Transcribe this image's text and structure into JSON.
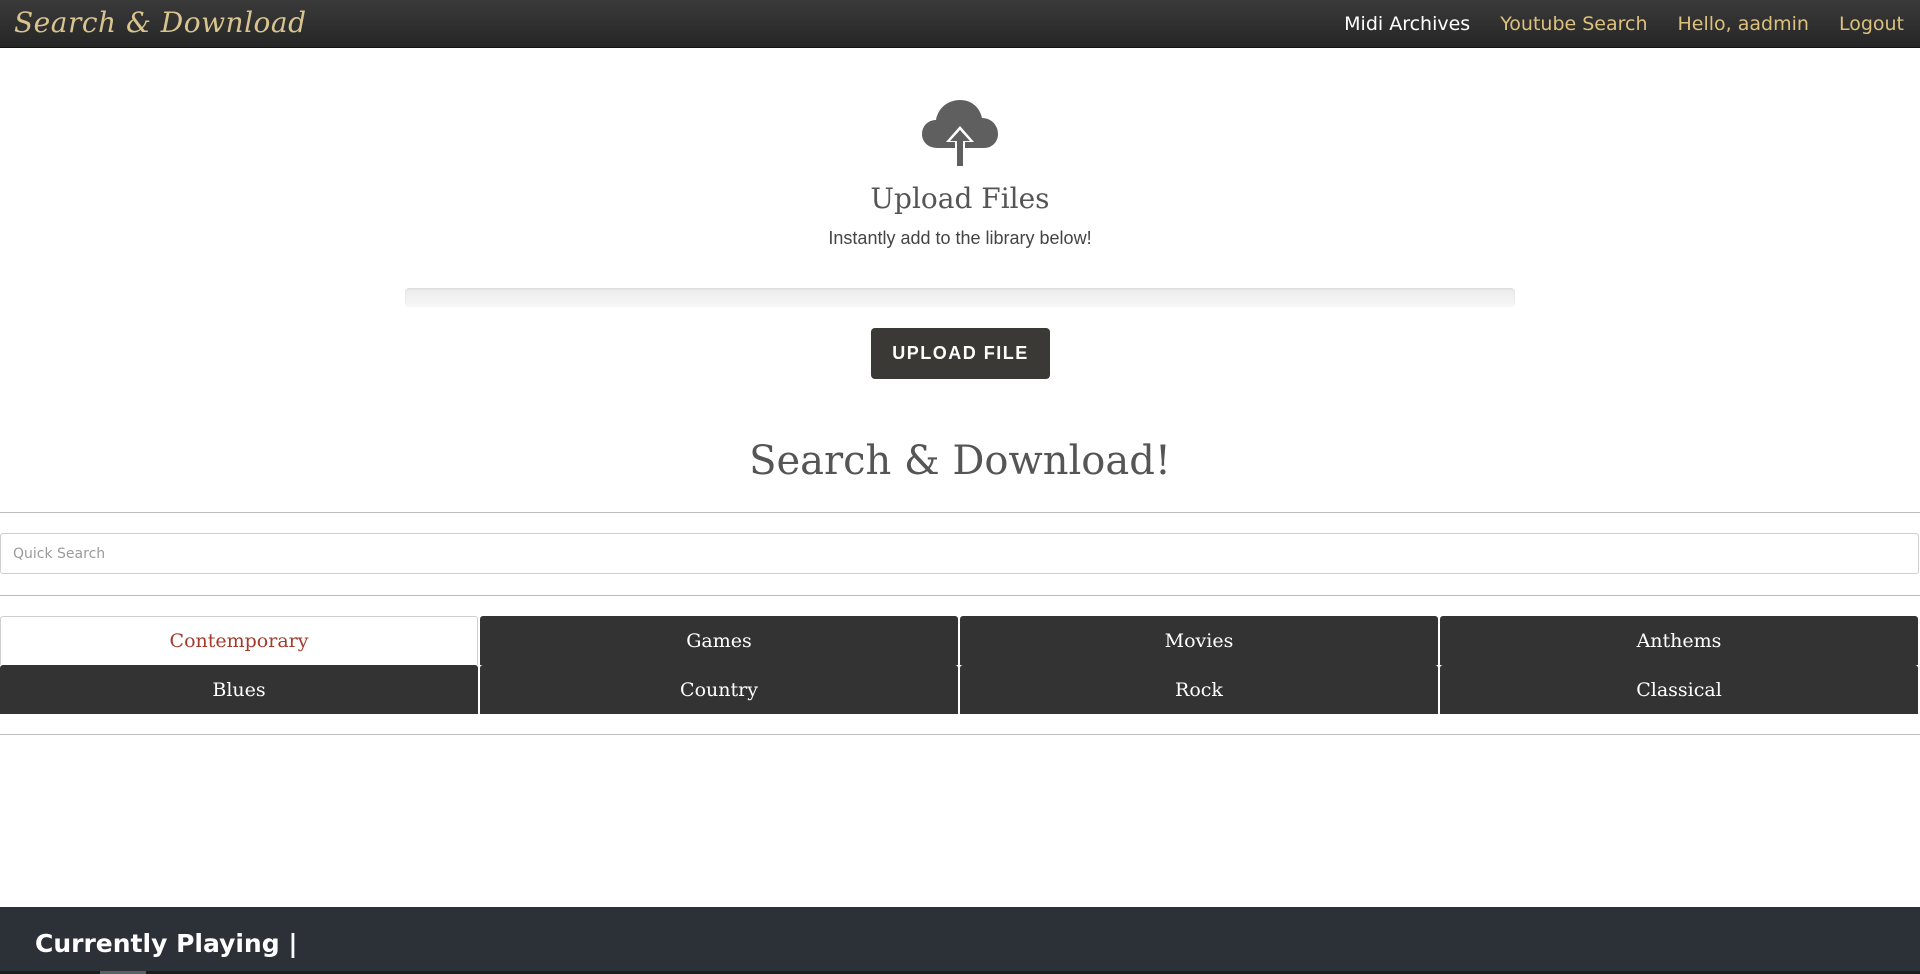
{
  "brand": "Search & Download",
  "nav": {
    "midi_archives": "Midi Archives",
    "youtube_search": "Youtube Search",
    "greeting": "Hello, aadmin",
    "logout": "Logout"
  },
  "upload": {
    "icon": "cloud-upload-icon",
    "title": "Upload Files",
    "subtitle": "Instantly add to the library below!",
    "progress": 0,
    "button_label": "UPLOAD FILE"
  },
  "search": {
    "title": "Search & Download!",
    "placeholder": "Quick Search"
  },
  "categories": [
    {
      "label": "Contemporary",
      "active": true
    },
    {
      "label": "Games",
      "active": false
    },
    {
      "label": "Movies",
      "active": false
    },
    {
      "label": "Anthems",
      "active": false
    },
    {
      "label": "Blues",
      "active": false
    },
    {
      "label": "Country",
      "active": false
    },
    {
      "label": "Rock",
      "active": false
    },
    {
      "label": "Classical",
      "active": false
    }
  ],
  "player": {
    "label": "Currently Playing |"
  },
  "colors": {
    "navbar": "#2e2e2e",
    "brand_gold": "#d8c48f",
    "tab_dark": "#333333",
    "tab_active_text": "#a33a2a",
    "button": "#3b3935",
    "footer": "#2b3137"
  }
}
